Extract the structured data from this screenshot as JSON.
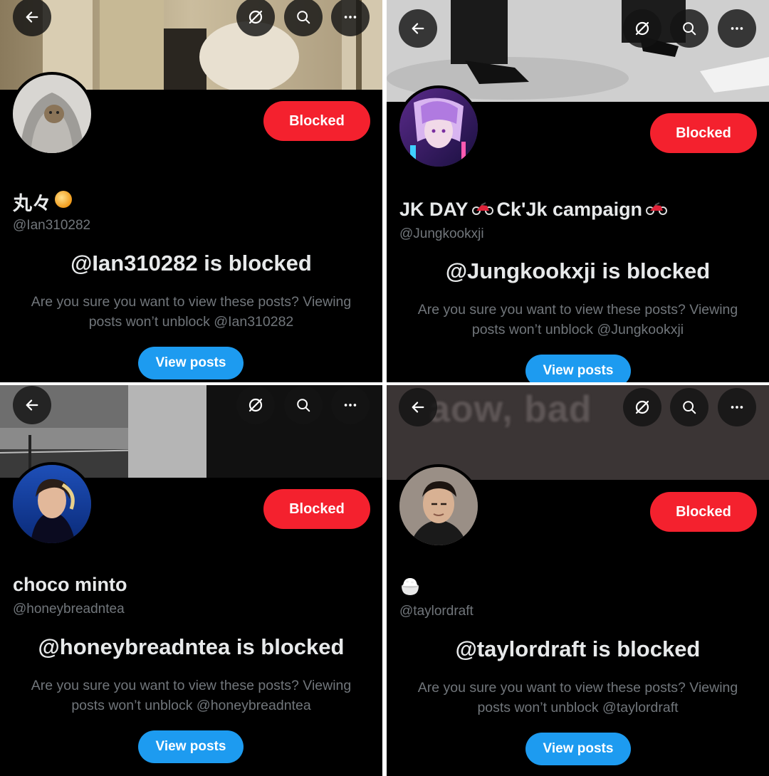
{
  "colors": {
    "background": "#000000",
    "blocked_button": "#f4212e",
    "view_posts_button": "#1d9bf0",
    "primary_text": "#e7e9ea",
    "secondary_text": "#71767b"
  },
  "icons": {
    "back": "arrow-left-icon",
    "grok": "grok-icon",
    "search": "search-icon",
    "more": "more-horizontal-icon",
    "sun_emoji": "orange-sun-emoji",
    "motorcycle_emoji": "motorcycle-emoji",
    "rice_emoji": "rice-bowl-emoji"
  },
  "panels": [
    {
      "display_name": "丸々",
      "handle": "@Ian310282",
      "blocked_label": "Blocked",
      "blocked_title": "@Ian310282 is blocked",
      "description": "Are you sure you want to view these posts? Viewing posts won’t unblock @Ian310282",
      "view_posts_label": "View posts"
    },
    {
      "display_name_part1": "JK DAY",
      "display_name_part2": "Ck'Jk campaign",
      "handle": "@Jungkookxji",
      "blocked_label": "Blocked",
      "blocked_title": "@Jungkookxji is blocked",
      "description": "Are you sure you want to view these posts? Viewing posts won’t unblock @Jungkookxji",
      "view_posts_label": "View posts"
    },
    {
      "display_name": "choco minto",
      "handle": "@honeybreadntea",
      "blocked_label": "Blocked",
      "blocked_title": "@honeybreadntea is blocked",
      "description": "Are you sure you want to view these posts? Viewing posts won’t unblock @honeybreadntea",
      "view_posts_label": "View posts"
    },
    {
      "banner_text": "aow, bad",
      "handle": "@taylordraft",
      "blocked_label": "Blocked",
      "blocked_title": "@taylordraft is blocked",
      "description": "Are you sure you want to view these posts? Viewing posts won’t unblock @taylordraft",
      "view_posts_label": "View posts"
    }
  ]
}
